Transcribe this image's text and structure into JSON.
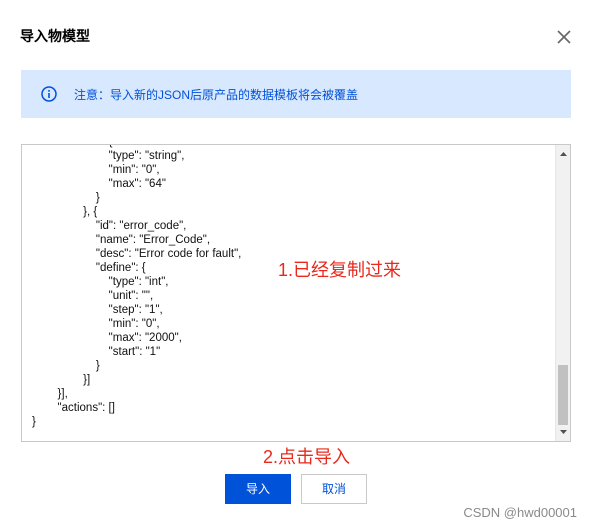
{
  "dialog": {
    "title": "导入物模型",
    "notice": "注意：导入新的JSON后原产品的数据模板将会被覆盖"
  },
  "editor": {
    "code": "                        {\n                        \"type\": \"string\",\n                        \"min\": \"0\",\n                        \"max\": \"64\"\n                    }\n                }, {\n                    \"id\": \"error_code\",\n                    \"name\": \"Error_Code\",\n                    \"desc\": \"Error code for fault\",\n                    \"define\": {\n                        \"type\": \"int\",\n                        \"unit\": \"\",\n                        \"step\": \"1\",\n                        \"min\": \"0\",\n                        \"max\": \"2000\",\n                        \"start\": \"1\"\n                    }\n                }]\n        }],\n        \"actions\": []\n}"
  },
  "annotations": {
    "step1": "1.已经复制过来",
    "step2": "2.点击导入"
  },
  "buttons": {
    "import": "导入",
    "cancel": "取消"
  },
  "watermark": "CSDN @hwd00001",
  "colors": {
    "primary": "#0052d9",
    "notice_bg": "#d8e8ff",
    "annotation": "#e8291c"
  },
  "icons": {
    "close": "close-icon",
    "info": "info-icon"
  }
}
